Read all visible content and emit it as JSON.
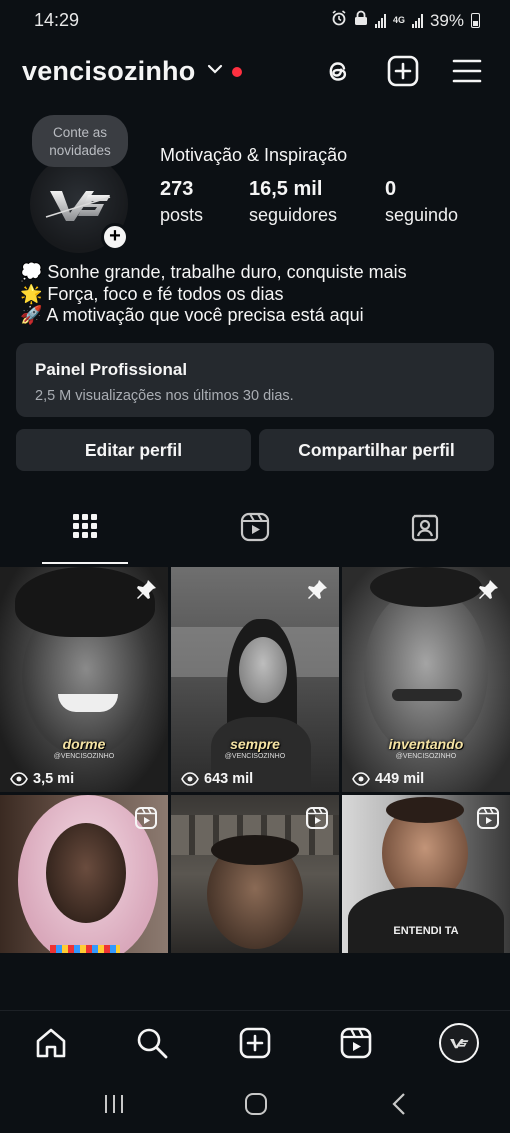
{
  "status_bar": {
    "time": "14:29",
    "network": "4G",
    "battery": "39%"
  },
  "header": {
    "username": "vencisozinho",
    "icons": [
      "chevron-down-icon",
      "threads-icon",
      "create-icon",
      "menu-icon"
    ],
    "notification_color": "#ff3040"
  },
  "profile": {
    "note": "Conte as novidades",
    "avatar_text": "VS",
    "category": "Motivação & Inspiração",
    "stats": {
      "posts_count": "273",
      "posts_label": "posts",
      "followers_count": "16,5 mil",
      "followers_label": "seguidores",
      "following_count": "0",
      "following_label": "seguindo"
    },
    "bio": [
      {
        "emoji": "💭",
        "text": " Sonhe grande, trabalhe duro, conquiste mais"
      },
      {
        "emoji": "🌟",
        "text": " Força, foco e fé todos os dias"
      },
      {
        "emoji": "🚀",
        "text": " A motivação que você precisa está aqui"
      }
    ]
  },
  "dashboard": {
    "title": "Painel Profissional",
    "subtitle": "2,5 M visualizações nos últimos 30 dias."
  },
  "actions": {
    "edit_profile": "Editar perfil",
    "share_profile": "Compartilhar perfil"
  },
  "tabs": [
    "grid-icon",
    "reels-icon",
    "tagged-icon"
  ],
  "grid": [
    {
      "caption": "dorme",
      "handle": "@VENCISOZINHO",
      "views": "3,5 mi",
      "pinned": true
    },
    {
      "caption": "sempre",
      "handle": "@VENCISOZINHO",
      "views": "643 mil",
      "pinned": true
    },
    {
      "caption": "inventando",
      "handle": "@VENCISOZINHO",
      "views": "449 mil",
      "pinned": true
    },
    {
      "caption": "",
      "handle": "",
      "views": "",
      "pinned": false
    },
    {
      "caption": "",
      "handle": "",
      "views": "",
      "pinned": false
    },
    {
      "caption": "",
      "handle": "",
      "views": "",
      "pinned": false,
      "shirt_text": "ENTENDI TA"
    }
  ],
  "bottom_nav": [
    "home-icon",
    "search-icon",
    "create-icon",
    "reels-icon",
    "profile-avatar"
  ],
  "colors": {
    "background": "#0c1014",
    "card": "#25292e",
    "text": "#f5f5f5",
    "muted": "#a9adb3"
  }
}
